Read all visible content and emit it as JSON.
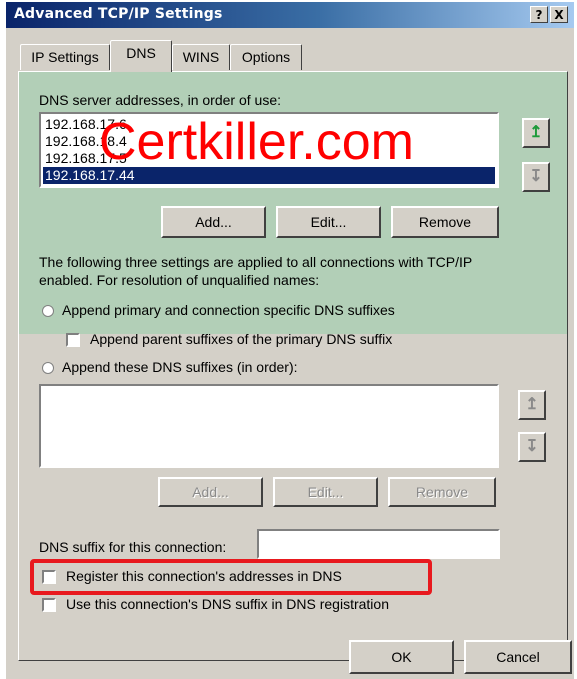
{
  "window": {
    "title": "Advanced TCP/IP Settings",
    "help_label": "?",
    "close_label": "X"
  },
  "tabs": [
    {
      "label": "IP Settings"
    },
    {
      "label": "DNS"
    },
    {
      "label": "WINS"
    },
    {
      "label": "Options"
    }
  ],
  "dns": {
    "servers_label": "DNS server addresses, in order of use:",
    "servers": [
      "192.168.17.6",
      "192.168.18.4",
      "192.168.17.5",
      "192.168.17.44"
    ],
    "selected_server_index": 3,
    "add_label": "Add...",
    "edit_label": "Edit...",
    "remove_label": "Remove",
    "info_text_1": "The following three settings are applied to all connections with TCP/IP",
    "info_text_2": "enabled. For resolution of unqualified names:",
    "option_primary_label": "Append primary and connection specific DNS suffixes",
    "option_parent_label": "Append parent suffixes of the primary DNS suffix",
    "option_these_label": "Append these DNS suffixes (in order):",
    "suffix_add_label": "Add...",
    "suffix_edit_label": "Edit...",
    "suffix_remove_label": "Remove",
    "connection_suffix_label": "DNS suffix for this connection:",
    "connection_suffix_value": "",
    "register_label": "Register this connection's addresses in DNS",
    "use_suffix_label": "Use this connection's DNS suffix in DNS registration"
  },
  "footer": {
    "ok_label": "OK",
    "cancel_label": "Cancel"
  },
  "watermark": "Certkiller.com",
  "colors": {
    "selection": "#0a246a",
    "watermark": "#ff0000",
    "highlight": "#e8191e",
    "up_arrow": "#1e9a3a"
  }
}
